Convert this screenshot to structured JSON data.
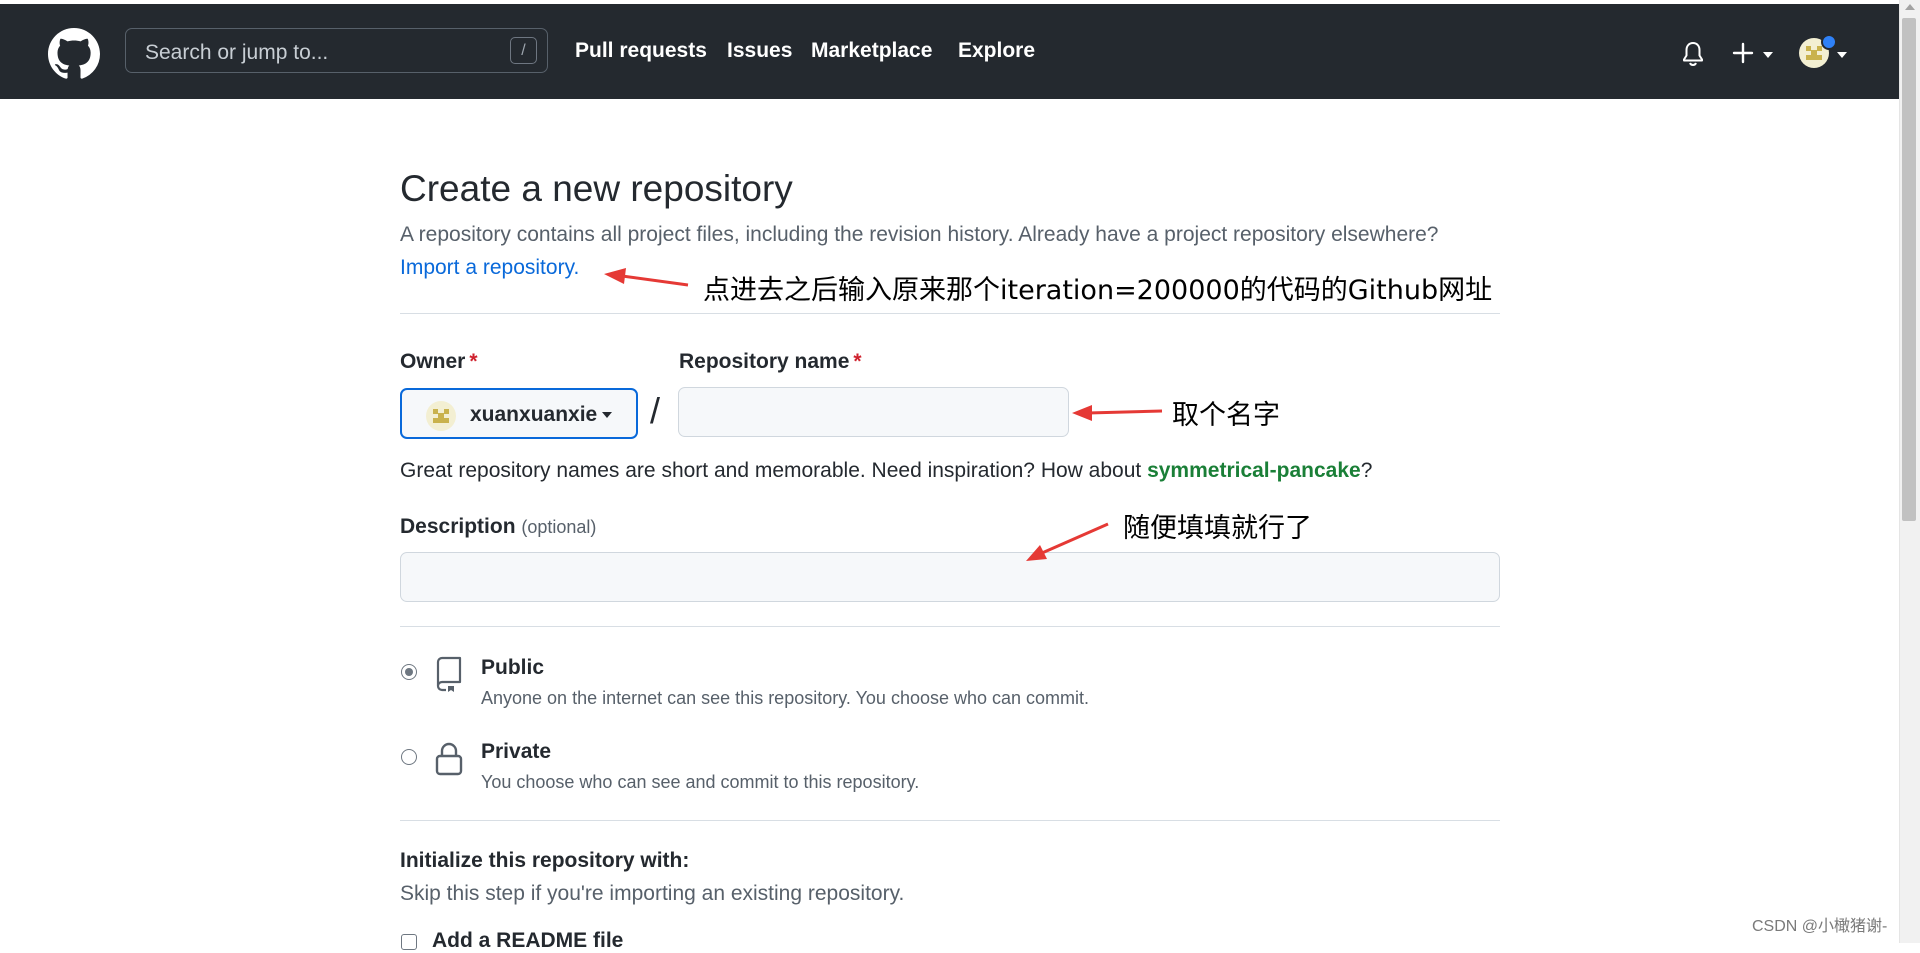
{
  "header": {
    "search_placeholder": "Search or jump to...",
    "search_shortcut": "/",
    "nav": [
      "Pull requests",
      "Issues",
      "Marketplace",
      "Explore"
    ],
    "icons": {
      "logo": "github-octocat-icon",
      "notifications": "bell-icon",
      "create": "plus-icon",
      "avatar": "user-avatar"
    }
  },
  "page": {
    "title": "Create a new repository",
    "subtitle": "A repository contains all project files, including the revision history. Already have a project repository elsewhere?",
    "import_link": "Import a repository."
  },
  "form": {
    "owner_label": "Owner",
    "required_mark": "*",
    "owner_value": "xuanxuanxie",
    "separator": "/",
    "repo_label": "Repository name",
    "repo_value": "",
    "hint_prefix": "Great repository names are short and memorable. Need inspiration? How about ",
    "hint_suggestion": "symmetrical-pancake",
    "hint_suffix": "?",
    "description_label": "Description",
    "description_optional": "(optional)",
    "description_value": ""
  },
  "visibility": {
    "selected": "public",
    "options": [
      {
        "title": "Public",
        "desc": "Anyone on the internet can see this repository. You choose who can commit.",
        "icon": "repo-book-icon"
      },
      {
        "title": "Private",
        "desc": "You choose who can see and commit to this repository.",
        "icon": "lock-icon"
      }
    ]
  },
  "init": {
    "title": "Initialize this repository with:",
    "desc": "Skip this step if you're importing an existing repository.",
    "readme_label": "Add a README file"
  },
  "annotations": {
    "import": "点进去之后输入原来那个iteration=200000的代码的Github网址",
    "name": "取个名字",
    "description": "随便填填就行了",
    "color": "#e53935"
  },
  "watermark": "CSDN @小橄猪谢-"
}
